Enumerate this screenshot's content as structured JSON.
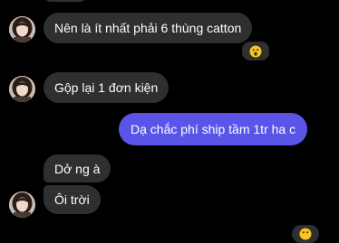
{
  "messages": [
    {
      "text": "Nên là ít nhất phải 6 thùng catton",
      "reaction": "wow"
    },
    {
      "text": "Gộp lại 1 đơn kiện"
    },
    {
      "text": "Dạ chắc phí ship tầm 1tr ha c"
    },
    {
      "text": "Dở ng à"
    },
    {
      "text": "Ôi trời",
      "reaction": "wow"
    }
  ],
  "colors": {
    "background": "#000000",
    "incoming_bubble": "#2f2f2f",
    "outgoing_bubble": "#5a55e8",
    "text": "#ffffff",
    "emoji": "#f7c325"
  }
}
